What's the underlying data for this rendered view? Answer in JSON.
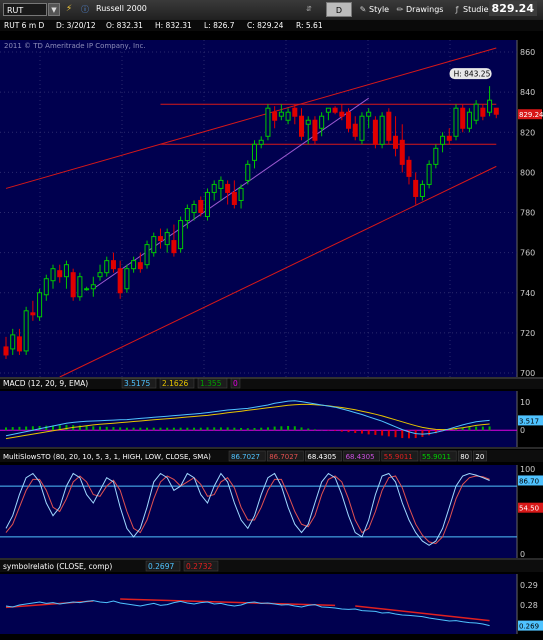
{
  "toolbar": {
    "symbol": "RUT",
    "title": "Russell 2000",
    "period": "D",
    "style_label": "Style",
    "drawings_label": "Drawings",
    "studies_label": "Studies",
    "last_price": "829.24"
  },
  "infoline": {
    "symbol": "RUT 6 m D",
    "date": "D: 3/20/12",
    "open": "O: 832.31",
    "high": "H: 832.31",
    "low": "L: 826.7",
    "close": "C: 829.24",
    "range": "R: 5.61"
  },
  "copyright": "2011 © TD Ameritrade IP Company, Inc.",
  "colors": {
    "bg": "#00004f",
    "up": "#00c800",
    "down": "#e00000",
    "red_line": "#d81818",
    "purple_line": "#9b59d0"
  },
  "chart_data": [
    {
      "type": "candlestick",
      "name": "price",
      "y_ticks": [
        700,
        720,
        740,
        760,
        780,
        800,
        820,
        840,
        860
      ],
      "ylim": [
        698,
        866
      ],
      "high_label": "H: 843.25",
      "last_label": "829.24",
      "candles": [
        {
          "o": 713,
          "h": 718,
          "l": 707,
          "c": 709
        },
        {
          "o": 712,
          "h": 722,
          "l": 709,
          "c": 719
        },
        {
          "o": 718,
          "h": 722,
          "l": 709,
          "c": 711
        },
        {
          "o": 711,
          "h": 733,
          "l": 709,
          "c": 731
        },
        {
          "o": 730,
          "h": 736,
          "l": 726,
          "c": 729
        },
        {
          "o": 728,
          "h": 742,
          "l": 726,
          "c": 740
        },
        {
          "o": 739,
          "h": 749,
          "l": 736,
          "c": 747
        },
        {
          "o": 746,
          "h": 754,
          "l": 742,
          "c": 752
        },
        {
          "o": 751,
          "h": 754,
          "l": 745,
          "c": 748
        },
        {
          "o": 748,
          "h": 756,
          "l": 742,
          "c": 754
        },
        {
          "o": 750,
          "h": 752,
          "l": 736,
          "c": 738
        },
        {
          "o": 738,
          "h": 750,
          "l": 736,
          "c": 748
        },
        {
          "o": 742,
          "h": 743,
          "l": 741,
          "c": 742
        },
        {
          "o": 742,
          "h": 748,
          "l": 738,
          "c": 744
        },
        {
          "o": 748,
          "h": 754,
          "l": 746,
          "c": 750
        },
        {
          "o": 750,
          "h": 758,
          "l": 748,
          "c": 756
        },
        {
          "o": 756,
          "h": 760,
          "l": 750,
          "c": 752
        },
        {
          "o": 752,
          "h": 756,
          "l": 737,
          "c": 740
        },
        {
          "o": 742,
          "h": 754,
          "l": 740,
          "c": 752
        },
        {
          "o": 752,
          "h": 758,
          "l": 750,
          "c": 756
        },
        {
          "o": 755,
          "h": 760,
          "l": 750,
          "c": 752
        },
        {
          "o": 754,
          "h": 766,
          "l": 752,
          "c": 764
        },
        {
          "o": 760,
          "h": 770,
          "l": 758,
          "c": 768
        },
        {
          "o": 768,
          "h": 772,
          "l": 762,
          "c": 766
        },
        {
          "o": 764,
          "h": 772,
          "l": 760,
          "c": 770
        },
        {
          "o": 766,
          "h": 774,
          "l": 758,
          "c": 760
        },
        {
          "o": 762,
          "h": 778,
          "l": 760,
          "c": 776
        },
        {
          "o": 776,
          "h": 784,
          "l": 772,
          "c": 782
        },
        {
          "o": 780,
          "h": 786,
          "l": 776,
          "c": 784
        },
        {
          "o": 786,
          "h": 788,
          "l": 778,
          "c": 780
        },
        {
          "o": 778,
          "h": 792,
          "l": 776,
          "c": 790
        },
        {
          "o": 790,
          "h": 796,
          "l": 786,
          "c": 794
        },
        {
          "o": 792,
          "h": 798,
          "l": 786,
          "c": 796
        },
        {
          "o": 794,
          "h": 796,
          "l": 784,
          "c": 790
        },
        {
          "o": 790,
          "h": 796,
          "l": 782,
          "c": 784
        },
        {
          "o": 786,
          "h": 794,
          "l": 782,
          "c": 792
        },
        {
          "o": 796,
          "h": 806,
          "l": 794,
          "c": 804
        },
        {
          "o": 806,
          "h": 816,
          "l": 802,
          "c": 814
        },
        {
          "o": 814,
          "h": 818,
          "l": 812,
          "c": 816
        },
        {
          "o": 818,
          "h": 834,
          "l": 816,
          "c": 832
        },
        {
          "o": 830,
          "h": 833,
          "l": 822,
          "c": 826
        },
        {
          "o": 828,
          "h": 834,
          "l": 826,
          "c": 830
        },
        {
          "o": 826,
          "h": 832,
          "l": 824,
          "c": 830
        },
        {
          "o": 832,
          "h": 834,
          "l": 824,
          "c": 828
        },
        {
          "o": 828,
          "h": 832,
          "l": 816,
          "c": 818
        },
        {
          "o": 824,
          "h": 828,
          "l": 814,
          "c": 826
        },
        {
          "o": 826,
          "h": 828,
          "l": 814,
          "c": 816
        },
        {
          "o": 822,
          "h": 830,
          "l": 818,
          "c": 828
        },
        {
          "o": 830,
          "h": 832,
          "l": 826,
          "c": 832
        },
        {
          "o": 832,
          "h": 833,
          "l": 829,
          "c": 830
        },
        {
          "o": 830,
          "h": 834,
          "l": 826,
          "c": 828
        },
        {
          "o": 830,
          "h": 832,
          "l": 820,
          "c": 822
        },
        {
          "o": 824,
          "h": 828,
          "l": 816,
          "c": 818
        },
        {
          "o": 816,
          "h": 830,
          "l": 814,
          "c": 828
        },
        {
          "o": 828,
          "h": 832,
          "l": 822,
          "c": 830
        },
        {
          "o": 826,
          "h": 828,
          "l": 812,
          "c": 814
        },
        {
          "o": 814,
          "h": 830,
          "l": 812,
          "c": 828
        },
        {
          "o": 830,
          "h": 832,
          "l": 814,
          "c": 816
        },
        {
          "o": 818,
          "h": 828,
          "l": 808,
          "c": 812
        },
        {
          "o": 816,
          "h": 824,
          "l": 800,
          "c": 804
        },
        {
          "o": 806,
          "h": 808,
          "l": 794,
          "c": 798
        },
        {
          "o": 796,
          "h": 800,
          "l": 784,
          "c": 788
        },
        {
          "o": 788,
          "h": 796,
          "l": 786,
          "c": 794
        },
        {
          "o": 794,
          "h": 806,
          "l": 792,
          "c": 804
        },
        {
          "o": 804,
          "h": 814,
          "l": 802,
          "c": 812
        },
        {
          "o": 814,
          "h": 820,
          "l": 810,
          "c": 818
        },
        {
          "o": 818,
          "h": 822,
          "l": 814,
          "c": 816
        },
        {
          "o": 818,
          "h": 834,
          "l": 816,
          "c": 832
        },
        {
          "o": 832,
          "h": 834,
          "l": 820,
          "c": 822
        },
        {
          "o": 822,
          "h": 832,
          "l": 820,
          "c": 830
        },
        {
          "o": 826,
          "h": 836,
          "l": 824,
          "c": 834
        },
        {
          "o": 832,
          "h": 834,
          "l": 826,
          "c": 828
        },
        {
          "o": 830,
          "h": 843,
          "l": 828,
          "c": 836
        },
        {
          "o": 832,
          "h": 832,
          "l": 827,
          "c": 829
        }
      ],
      "lines": [
        {
          "name": "upper-channel",
          "color": "#d81818",
          "p1": [
            0,
            792
          ],
          "p2": [
            73,
            862
          ]
        },
        {
          "name": "lower-channel",
          "color": "#d81818",
          "p1": [
            8,
            698
          ],
          "p2": [
            73,
            803
          ]
        },
        {
          "name": "resistance",
          "color": "#d81818",
          "p1": [
            23,
            834
          ],
          "p2": [
            73,
            834
          ]
        },
        {
          "name": "support",
          "color": "#d81818",
          "p1": [
            23,
            814
          ],
          "p2": [
            73,
            814
          ]
        },
        {
          "name": "trend",
          "color": "#9b59d0",
          "p1": [
            13,
            742
          ],
          "p2": [
            54,
            837
          ]
        }
      ]
    },
    {
      "type": "line",
      "name": "macd",
      "label": "MACD (12, 20, 9, EMA)",
      "values_shown": [
        "3.5175",
        "2.1626",
        "1.355",
        "0"
      ],
      "value_colors": [
        "#4fc3ff",
        "#e8c400",
        "#00a000",
        "#e000e0"
      ],
      "y_ticks": [
        10,
        0
      ],
      "last_value_tag": "3.517",
      "ylim": [
        -6,
        14
      ],
      "macd": [
        -2,
        -1.5,
        -1,
        -0.5,
        0,
        0.5,
        1,
        1.5,
        2,
        2.5,
        2.8,
        3,
        3.2,
        3.3,
        3.4,
        3.5,
        3.6,
        3.7,
        3.8,
        4,
        4.2,
        4.4,
        4.6,
        4.8,
        5,
        5.2,
        5.4,
        5.6,
        5.8,
        6,
        6.3,
        6.6,
        6.9,
        7.2,
        7.4,
        7.6,
        7.8,
        8.2,
        8.6,
        9,
        9.6,
        10,
        10.4,
        10.5,
        10.2,
        9.8,
        9.4,
        9,
        8.6,
        8.2,
        7.6,
        7,
        6.3,
        5.6,
        4.8,
        4,
        3.2,
        2.2,
        1.2,
        0.2,
        -0.6,
        -1.2,
        -1.4,
        -1.2,
        -0.8,
        -0.2,
        0.5,
        1.2,
        1.9,
        2.5,
        3,
        3.3,
        3.5
      ],
      "signal": [
        -3,
        -2.6,
        -2.2,
        -1.8,
        -1.4,
        -1,
        -0.6,
        -0.2,
        0.2,
        0.6,
        1,
        1.3,
        1.6,
        1.9,
        2.1,
        2.3,
        2.5,
        2.7,
        2.9,
        3.1,
        3.3,
        3.5,
        3.7,
        3.9,
        4.1,
        4.3,
        4.5,
        4.7,
        4.9,
        5.1,
        5.3,
        5.6,
        5.9,
        6.2,
        6.5,
        6.8,
        7.1,
        7.4,
        7.7,
        8,
        8.3,
        8.6,
        8.9,
        9.1,
        9.2,
        9.2,
        9.1,
        8.9,
        8.7,
        8.4,
        8.1,
        7.7,
        7.3,
        6.8,
        6.3,
        5.7,
        5.1,
        4.4,
        3.7,
        3,
        2.3,
        1.6,
        1,
        0.6,
        0.3,
        0.2,
        0.3,
        0.6,
        0.9,
        1.3,
        1.7,
        2,
        2.2
      ],
      "histogram": [
        1,
        1.1,
        1.2,
        1.3,
        1.4,
        1.5,
        1.6,
        1.7,
        1.8,
        1.9,
        1.8,
        1.7,
        1.6,
        1.4,
        1.3,
        1.2,
        1.1,
        1,
        0.9,
        0.9,
        0.9,
        0.9,
        0.9,
        0.9,
        0.9,
        0.9,
        0.9,
        0.9,
        0.9,
        0.9,
        1,
        1,
        1,
        1,
        0.9,
        0.8,
        0.7,
        0.8,
        0.9,
        1,
        1.3,
        1.4,
        1.5,
        1.4,
        1,
        0.6,
        0.3,
        0.1,
        -0.1,
        -0.2,
        -0.5,
        -0.7,
        -1,
        -1.2,
        -1.5,
        -1.7,
        -1.9,
        -2.2,
        -2.5,
        -2.8,
        -2.9,
        -2.8,
        -2.4,
        -1.8,
        -1.1,
        -0.4,
        0.2,
        0.6,
        1,
        1.2,
        1.3,
        1.3,
        1.355
      ]
    },
    {
      "type": "line",
      "name": "stochastic",
      "label": "MultiSlowSTO (80, 20, 10, 5, 3, 1, HIGH, LOW, CLOSE, SMA)",
      "values_shown": [
        "86.7027",
        "86.7027",
        "68.4305",
        "68.4305",
        "55.9011",
        "55.9011",
        "80",
        "20"
      ],
      "value_colors": [
        "#4fc3ff",
        "#e05050",
        "#ffffff",
        "#cc4fe0",
        "#e02020",
        "#00d000",
        "#ffffff",
        "#ffffff"
      ],
      "y_ticks": [
        100,
        0
      ],
      "tags": [
        "86.70",
        "54.50"
      ],
      "ylim": [
        -5,
        105
      ],
      "levels": [
        80,
        20
      ],
      "fast": [
        30,
        45,
        70,
        90,
        95,
        85,
        60,
        45,
        55,
        80,
        95,
        90,
        70,
        60,
        75,
        90,
        85,
        55,
        30,
        20,
        30,
        55,
        85,
        95,
        90,
        75,
        80,
        95,
        90,
        70,
        60,
        80,
        95,
        85,
        60,
        40,
        30,
        45,
        70,
        90,
        95,
        80,
        55,
        35,
        25,
        35,
        60,
        85,
        95,
        90,
        70,
        45,
        25,
        20,
        40,
        70,
        92,
        95,
        85,
        60,
        40,
        25,
        15,
        10,
        15,
        30,
        55,
        80,
        92,
        95,
        93,
        90,
        86.7
      ],
      "slow": [
        25,
        35,
        55,
        75,
        88,
        88,
        75,
        55,
        50,
        65,
        85,
        92,
        85,
        70,
        68,
        80,
        87,
        75,
        50,
        30,
        25,
        40,
        65,
        85,
        92,
        88,
        80,
        85,
        90,
        82,
        68,
        70,
        85,
        90,
        78,
        55,
        40,
        40,
        55,
        75,
        88,
        88,
        70,
        50,
        35,
        32,
        45,
        70,
        88,
        92,
        85,
        65,
        40,
        25,
        30,
        50,
        75,
        90,
        92,
        78,
        55,
        35,
        22,
        14,
        12,
        20,
        40,
        65,
        82,
        90,
        92,
        91,
        88
      ]
    },
    {
      "type": "line",
      "name": "symbolrelation",
      "label": "symbolrelatio (CLOSE, comp)",
      "values_shown": [
        "0.2697",
        "0.2732"
      ],
      "value_colors": [
        "#4fc3ff",
        "#e02020"
      ],
      "y_ticks": [
        0.29,
        0.28
      ],
      "tag": "0.269",
      "ylim": [
        0.2655,
        0.2955
      ],
      "values": [
        0.2795,
        0.279,
        0.28,
        0.2805,
        0.281,
        0.2815,
        0.2808,
        0.2812,
        0.2805,
        0.281,
        0.2815,
        0.2812,
        0.2818,
        0.2822,
        0.2815,
        0.2812,
        0.282,
        0.281,
        0.2805,
        0.28,
        0.2795,
        0.2802,
        0.2808,
        0.2798,
        0.2802,
        0.2812,
        0.2818,
        0.281,
        0.2805,
        0.2812,
        0.2815,
        0.2805,
        0.2808,
        0.28,
        0.2795,
        0.28,
        0.2812,
        0.2815,
        0.2808,
        0.281,
        0.2805,
        0.28,
        0.2802,
        0.2795,
        0.279,
        0.2798,
        0.2802,
        0.279,
        0.2788,
        0.2785,
        0.278,
        0.2778,
        0.278,
        0.2772,
        0.277,
        0.2768,
        0.276,
        0.2762,
        0.2755,
        0.275,
        0.2748,
        0.2745,
        0.2742,
        0.2735,
        0.273,
        0.2725,
        0.272,
        0.2722,
        0.2716,
        0.2712,
        0.271,
        0.2705,
        0.2697
      ],
      "trend_lines": [
        {
          "p1": [
            0,
            0.2788
          ],
          "p2": [
            13,
            0.282
          ]
        },
        {
          "p1": [
            17,
            0.283
          ],
          "p2": [
            49,
            0.2798
          ]
        },
        {
          "p1": [
            52,
            0.2795
          ],
          "p2": [
            72,
            0.2722
          ]
        }
      ]
    }
  ]
}
